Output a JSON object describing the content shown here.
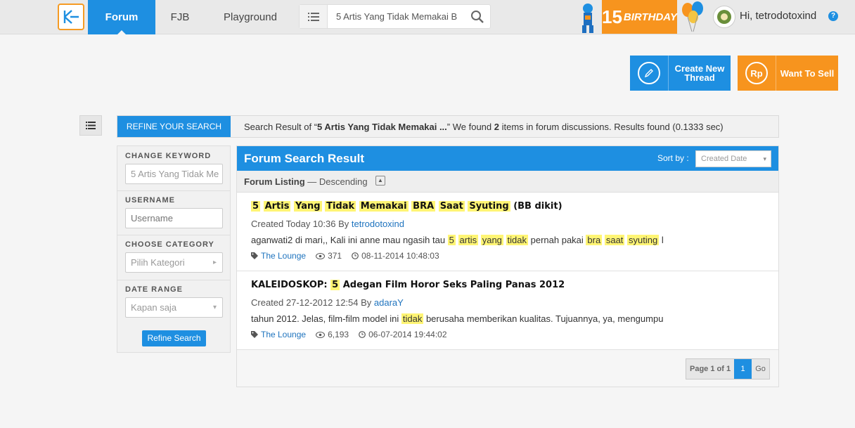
{
  "topbar": {
    "nav": [
      "Forum",
      "FJB",
      "Playground"
    ],
    "search_value": "5 Artis Yang Tidak Memakai B",
    "birthday_num": "15",
    "birthday_word": "BIRTHDAY",
    "greeting": "Hi, tetrodotoxind",
    "help": "?"
  },
  "actions": {
    "create_line1": "Create New",
    "create_line2": "Thread",
    "sell": "Want To Sell",
    "sell_icon": "Rp"
  },
  "summary": {
    "refine_tab": "REFINE YOUR SEARCH",
    "prefix": "Search Result of “",
    "query": "5 Artis Yang Tidak Memakai ...",
    "middle": "” We found ",
    "count": "2",
    "suffix": " items in forum discussions. Results found (0.1333 sec)"
  },
  "sidebar": {
    "keyword_label": "CHANGE KEYWORD",
    "keyword_value": "5 Artis Yang Tidak Me",
    "username_label": "USERNAME",
    "username_placeholder": "Username",
    "category_label": "CHOOSE CATEGORY",
    "category_value": "Pilih Kategori",
    "date_label": "DATE RANGE",
    "date_value": "Kapan saja",
    "refine_button": "Refine Search"
  },
  "results": {
    "title": "Forum Search Result",
    "sort_label": "Sort by :",
    "sort_value": "Created Date",
    "listing_label": "Forum Listing",
    "listing_order": " — Descending",
    "items": [
      {
        "title_hl": [
          "5",
          "Artis",
          "Yang",
          "Tidak",
          "Memakai",
          "BRA",
          "Saat",
          "Syuting"
        ],
        "title_rest": "(BB dikit)",
        "created": "Created Today 10:36 By ",
        "author": "tetrodotoxind",
        "snippet_start": "aganwati2 di mari,, Kali ini anne mau ngasih tau ",
        "snippet_hl1": [
          "5",
          "artis",
          "yang",
          "tidak"
        ],
        "snippet_mid": " pernah pakai ",
        "snippet_hl2": [
          "bra",
          "saat",
          "syuting"
        ],
        "snippet_end": " l",
        "category": "The Lounge",
        "views": "371",
        "date": "08-11-2014 10:48:03"
      },
      {
        "title_prefix": "KALEIDOSKOP: ",
        "title_hl": "5",
        "title_suffix": " Adegan Film Horor Seks Paling Panas 2012",
        "created": "Created 27-12-2012 12:54 By ",
        "author": "adaraY",
        "snippet_start": "tahun 2012. Jelas, film-film model ini ",
        "snippet_hl": "tidak",
        "snippet_end": " berusaha memberikan kualitas. Tujuannya, ya, mengumpu",
        "category": "The Lounge",
        "views": "6,193",
        "date": "06-07-2014 19:44:02"
      }
    ],
    "pager_info": "Page 1 of 1",
    "pager_current": "1",
    "pager_go": "Go"
  }
}
